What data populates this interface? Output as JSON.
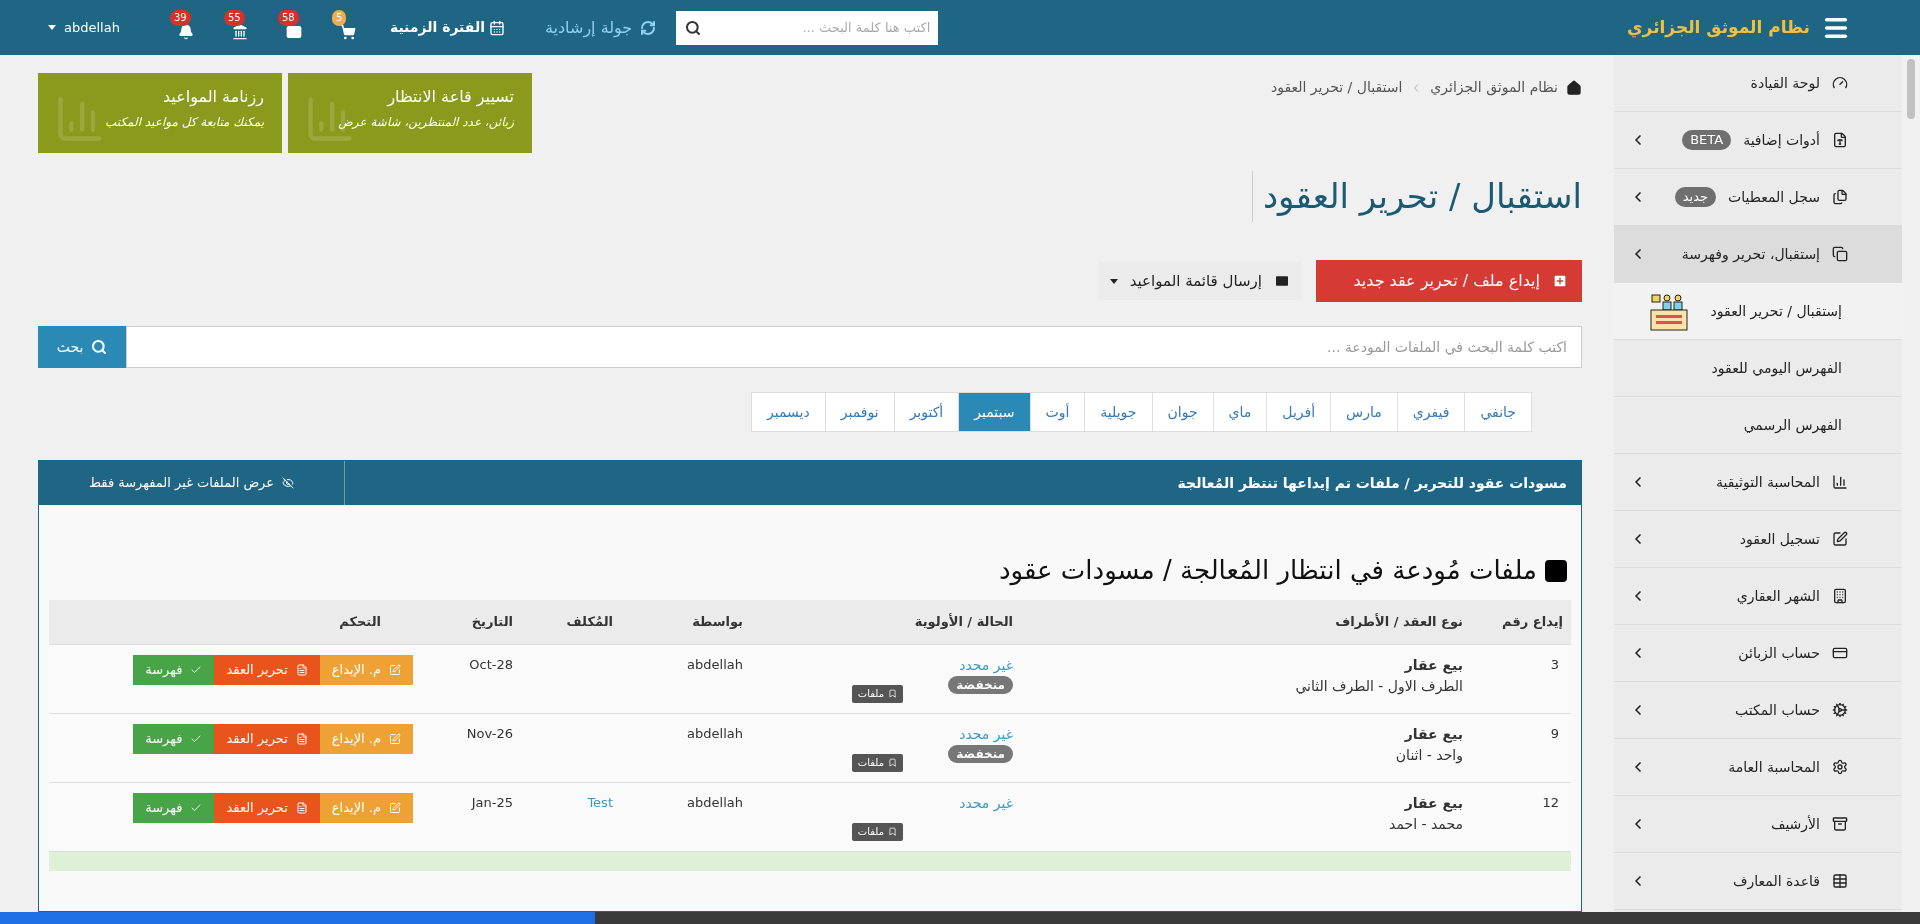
{
  "top_bar": {
    "brand": "نظام الموثق الجزائري",
    "search": {
      "placeholder": "اكتب هنا كلمة البحث ..."
    },
    "tour": "جولة إرشادية",
    "period": "الفترة الزمنية",
    "notifications": [
      {
        "count": "5",
        "color": "#f0ad4e"
      },
      {
        "count": "58",
        "color": "#d9302c"
      },
      {
        "count": "55",
        "color": "#d9302c"
      },
      {
        "count": "39",
        "color": "#d9302c"
      }
    ],
    "user": "abdellah"
  },
  "sidebar": {
    "items": [
      {
        "label": "لوحة القيادة",
        "has_arrow": false,
        "selected": false
      },
      {
        "label": "أدوات إضافية",
        "badge": "BETA",
        "has_arrow": true,
        "selected": false
      },
      {
        "label": "سجل المعطيات",
        "badge": "جديد",
        "has_arrow": true,
        "selected": false
      },
      {
        "label": "إستقبال، تحرير وفهرسة",
        "has_arrow": true,
        "selected": true,
        "children": [
          {
            "label": "إستقبال / تحرير العقود",
            "selected": true
          },
          {
            "label": "الفهرس اليومي للعقود",
            "selected": false
          },
          {
            "label": "الفهرس الرسمي",
            "selected": false
          }
        ]
      },
      {
        "label": "المحاسبة التوثيقية",
        "has_arrow": true,
        "selected": false
      },
      {
        "label": "تسجيل العقود",
        "has_arrow": true,
        "selected": false
      },
      {
        "label": "الشهر العقاري",
        "has_arrow": true,
        "selected": false
      },
      {
        "label": "حساب الزبائن",
        "has_arrow": true,
        "selected": false
      },
      {
        "label": "حساب المكتب",
        "has_arrow": true,
        "selected": false
      },
      {
        "label": "المحاسبة العامة",
        "has_arrow": true,
        "selected": false
      },
      {
        "label": "الأرشيف",
        "has_arrow": true,
        "selected": false
      },
      {
        "label": "قاعدة المعارف",
        "has_arrow": true,
        "selected": false
      }
    ]
  },
  "breadcrumb": [
    "نظام الموثق الجزائري",
    "استقبال / تحرير العقود"
  ],
  "tiles": [
    {
      "title": "تسيير قاعة الانتظار",
      "subtitle": "زبائن، عدد المنتظرين، شاشة عرض"
    },
    {
      "title": "رزنامة المواعيد",
      "subtitle": "يمكنك متابعة كل مواعيد المكتب"
    }
  ],
  "page_title": "استقبال / تحرير العقود",
  "actions": {
    "primary": "إيداع ملف / تحرير عقد جديد",
    "secondary": "إرسال قائمة المواعيد"
  },
  "file_search": {
    "placeholder": "اكتب كلمة البحث في الملفات المودعة ...",
    "button": "بحث"
  },
  "months": [
    {
      "label": "جانفي",
      "selected": false
    },
    {
      "label": "فيفري",
      "selected": false
    },
    {
      "label": "مارس",
      "selected": false
    },
    {
      "label": "أفريل",
      "selected": false
    },
    {
      "label": "ماي",
      "selected": false
    },
    {
      "label": "جوان",
      "selected": false
    },
    {
      "label": "جويلية",
      "selected": false
    },
    {
      "label": "أوت",
      "selected": false
    },
    {
      "label": "سبتمبر",
      "selected": true
    },
    {
      "label": "أكتوبر",
      "selected": false
    },
    {
      "label": "نوفمبر",
      "selected": false
    },
    {
      "label": "ديسمبر",
      "selected": false
    }
  ],
  "panel": {
    "title": "مسودات عقود للتحرير / ملفات تم إيداعها تنتظر المُعالجة",
    "filter_button": "عرض الملفات غير المفهرسة فقط",
    "heading": "ملفات مُودعة في انتظار المُعالجة / مسودات عقود",
    "table": {
      "columns": [
        "إيداع رقم",
        "نوع العقد / الأطراف",
        "الحالة / الأولوية",
        "بواسطة",
        "المُكلف",
        "التاريخ",
        "التحكم"
      ],
      "rows": [
        {
          "number": "3",
          "type": "بيع عقار",
          "parties": "الطرف الاول - الطرف الثاني",
          "tag": "ملفات",
          "status": "غير محدد",
          "priority": "منخفضة",
          "by": "abdellah",
          "date": "Oct-28",
          "actions": [
            {
              "kind": "deposit",
              "label": "م. الإيداع"
            },
            {
              "kind": "edit",
              "label": "تحرير العقد"
            },
            {
              "kind": "index",
              "label": "فهرسة"
            }
          ]
        },
        {
          "number": "9",
          "type": "بيع عقار",
          "parties": "واحد - اثنان",
          "tag": "ملفات",
          "status": "غير محدد",
          "priority": "منخفضة",
          "by": "abdellah",
          "date": "Nov-26",
          "actions": [
            {
              "kind": "deposit",
              "label": "م. الإيداع"
            },
            {
              "kind": "edit",
              "label": "تحرير العقد"
            },
            {
              "kind": "index",
              "label": "فهرسة"
            }
          ]
        },
        {
          "number": "12",
          "type": "بيع عقار",
          "parties": "محمد - احمد",
          "tag": "ملفات",
          "status": "غير محدد",
          "by": "abdellah",
          "assignee": "Test",
          "date": "Jan-25",
          "actions": [
            {
              "kind": "deposit",
              "label": "م. الإيداع"
            },
            {
              "kind": "edit",
              "label": "تحرير العقد"
            },
            {
              "kind": "index",
              "label": "فهرسة"
            }
          ]
        }
      ]
    }
  },
  "page_loader": {
    "level": 0.31
  }
}
